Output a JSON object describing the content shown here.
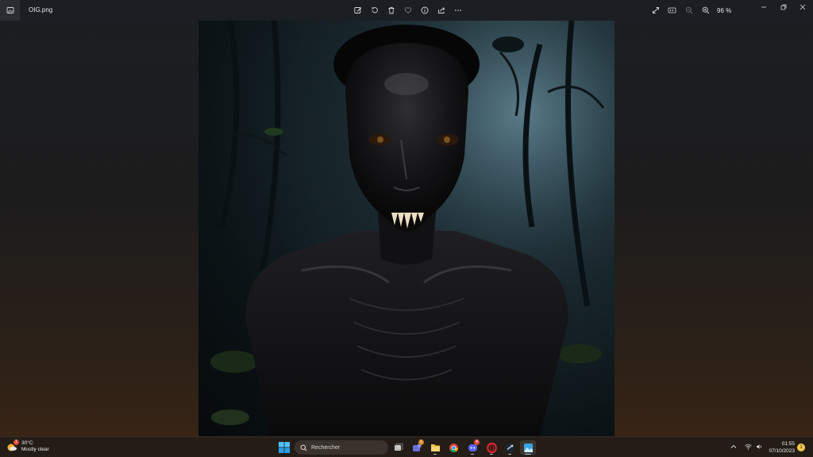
{
  "window": {
    "filename": "OIG.png",
    "zoom_label": "96 %"
  },
  "toolbar": {
    "icons": [
      "edit-image-icon",
      "rotate-icon",
      "delete-icon",
      "favorite-icon",
      "info-icon",
      "share-icon",
      "more-icon"
    ],
    "right_icons": [
      "fullscreen-icon",
      "actual-size-icon",
      "zoom-out-icon",
      "zoom-in-icon"
    ]
  },
  "window_controls": [
    "minimize-icon",
    "restore-icon",
    "close-icon"
  ],
  "taskbar": {
    "weather": {
      "temperature": "30°C",
      "condition": "Mostly clear",
      "alert_count": "1"
    },
    "search_placeholder": "Rechercher",
    "apps": [
      {
        "name": "task-view",
        "active": false,
        "running": false
      },
      {
        "name": "chat",
        "badge": "1",
        "running": false
      },
      {
        "name": "file-explorer",
        "running": true
      },
      {
        "name": "chrome",
        "running": false
      },
      {
        "name": "discord",
        "badge": "4",
        "running": true
      },
      {
        "name": "opera",
        "running": true
      },
      {
        "name": "steam",
        "running": true
      },
      {
        "name": "photos",
        "active": true,
        "running": true
      }
    ],
    "clock": {
      "time": "01:55",
      "date": "07/10/2023"
    },
    "notification_count": "1"
  },
  "colors": {
    "accent": "#4cc2ff",
    "taskbar_bg": "#241d17",
    "discord": "#5865f2",
    "opera": "#e3262f",
    "steam": "#1b2838"
  }
}
